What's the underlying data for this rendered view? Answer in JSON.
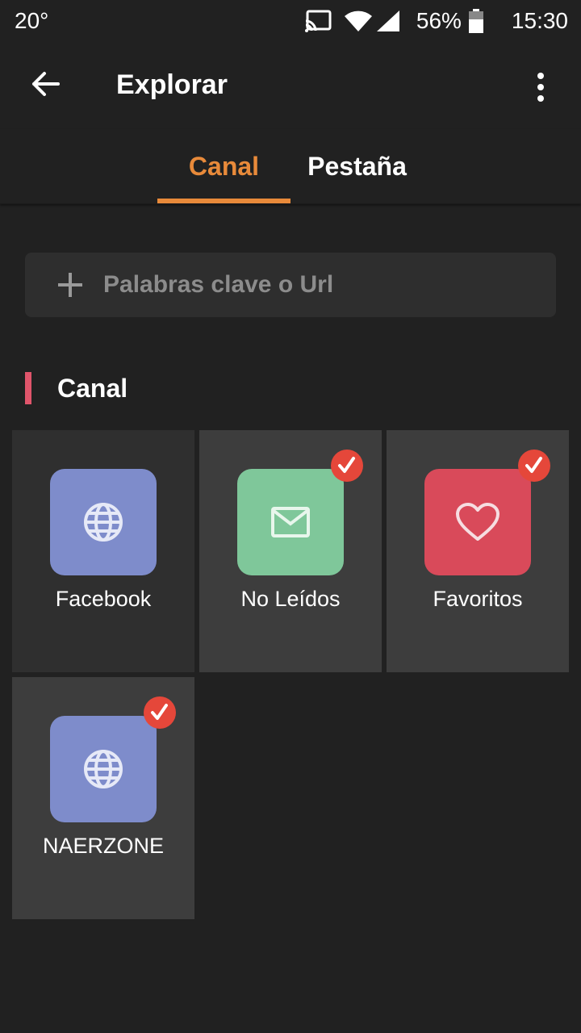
{
  "status_bar": {
    "temperature": "20°",
    "battery": "56%",
    "time": "15:30"
  },
  "app_bar": {
    "title": "Explorar"
  },
  "tabs": [
    {
      "label": "Canal",
      "active": true
    },
    {
      "label": "Pestaña",
      "active": false
    }
  ],
  "search": {
    "placeholder": "Palabras clave o Url"
  },
  "section": {
    "title": "Canal"
  },
  "channels": [
    {
      "label": "Facebook",
      "icon": "globe-icon",
      "color": "#7e8ccb",
      "tile_bg": "#2f2f2f",
      "checked": false
    },
    {
      "label": "No Leídos",
      "icon": "mail-icon",
      "color": "#7fc79a",
      "tile_bg": "#3d3d3d",
      "checked": true
    },
    {
      "label": "Favoritos",
      "icon": "heart-icon",
      "color": "#d94a5a",
      "tile_bg": "#3d3d3d",
      "checked": true
    },
    {
      "label": "NAERZONE",
      "icon": "globe-icon",
      "color": "#7e8ccb",
      "tile_bg": "#3d3d3d",
      "checked": true
    }
  ],
  "colors": {
    "accent": "#e88a3a",
    "section_bar": "#e0556b",
    "check_badge": "#e5473a",
    "background": "#212121"
  }
}
